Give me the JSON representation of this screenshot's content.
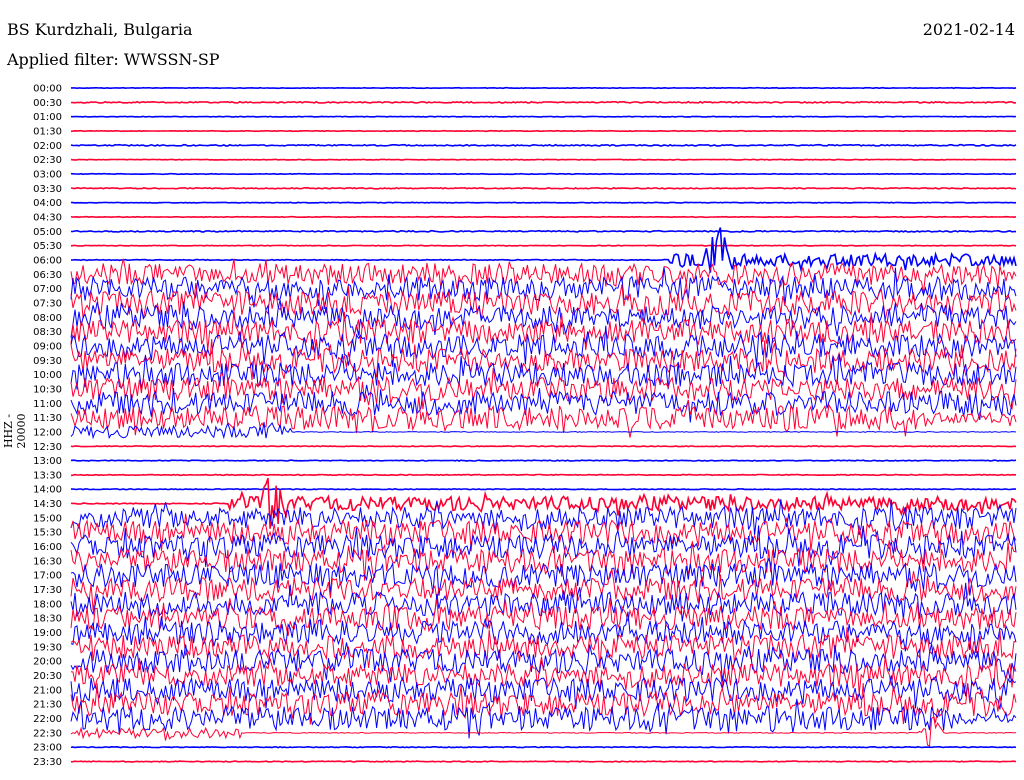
{
  "header": {
    "station": "BS Kurdzhali, Bulgaria",
    "filter": "Applied filter: WWSSN-SP",
    "date": "2021-02-14"
  },
  "chart_data": {
    "type": "line",
    "title": "BS Kurdzhali, Bulgaria",
    "ylabel": "HHZ - 20000",
    "xlabel": "",
    "x_unit": "minutes within 30-minute row",
    "xlim": [
      0,
      30
    ],
    "colors": {
      "even": "#0000ff",
      "odd": "#ff0033"
    },
    "rows": [
      {
        "time": "00:00",
        "amp": 0.3,
        "from": 0,
        "to": 30
      },
      {
        "time": "00:30",
        "amp": 0.6,
        "from": 0,
        "to": 30
      },
      {
        "time": "01:00",
        "amp": 0.3,
        "from": 0,
        "to": 30
      },
      {
        "time": "01:30",
        "amp": 0.3,
        "from": 0,
        "to": 30
      },
      {
        "time": "02:00",
        "amp": 0.6,
        "from": 0,
        "to": 30
      },
      {
        "time": "02:30",
        "amp": 0.3,
        "from": 0,
        "to": 30
      },
      {
        "time": "03:00",
        "amp": 0.3,
        "from": 0,
        "to": 30
      },
      {
        "time": "03:30",
        "amp": 0.5,
        "from": 0,
        "to": 30
      },
      {
        "time": "04:00",
        "amp": 0.3,
        "from": 0,
        "to": 30
      },
      {
        "time": "04:30",
        "amp": 0.3,
        "from": 0,
        "to": 30
      },
      {
        "time": "05:00",
        "amp": 0.6,
        "from": 0,
        "to": 30
      },
      {
        "time": "05:30",
        "amp": 0.3,
        "from": 0,
        "to": 30
      },
      {
        "time": "06:00",
        "amp": 0.4,
        "from": 0,
        "to": 30,
        "noisy_from": 19,
        "noisy_amp": 6,
        "spike_at": 20.5,
        "spike_amp": 40
      },
      {
        "time": "06:30",
        "amp": 11,
        "from": 0,
        "to": 30
      },
      {
        "time": "07:00",
        "amp": 12,
        "from": 0,
        "to": 30
      },
      {
        "time": "07:30",
        "amp": 12,
        "from": 0,
        "to": 30
      },
      {
        "time": "08:00",
        "amp": 12,
        "from": 0,
        "to": 30
      },
      {
        "time": "08:30",
        "amp": 12,
        "from": 0,
        "to": 30
      },
      {
        "time": "09:00",
        "amp": 12,
        "from": 0,
        "to": 30
      },
      {
        "time": "09:30",
        "amp": 12,
        "from": 0,
        "to": 30
      },
      {
        "time": "10:00",
        "amp": 12,
        "from": 0,
        "to": 30
      },
      {
        "time": "10:30",
        "amp": 12,
        "from": 0,
        "to": 30
      },
      {
        "time": "11:00",
        "amp": 12,
        "from": 0,
        "to": 30
      },
      {
        "time": "11:30",
        "amp": 12,
        "from": 0,
        "to": 30,
        "drop_at": 27.2,
        "drop_amp": 5
      },
      {
        "time": "12:00",
        "amp": 6,
        "from": 0,
        "to": 30,
        "quiet_after": 7,
        "spike_at": 6.4,
        "spike_amp": 14
      },
      {
        "time": "12:30",
        "amp": 0.4,
        "from": 0,
        "to": 30
      },
      {
        "time": "13:00",
        "amp": 0.4,
        "from": 0,
        "to": 30
      },
      {
        "time": "13:30",
        "amp": 0.4,
        "from": 0,
        "to": 30
      },
      {
        "time": "14:00",
        "amp": 0.4,
        "from": 0,
        "to": 30
      },
      {
        "time": "14:30",
        "amp": 0.5,
        "from": 0,
        "to": 30,
        "noisy_from": 5,
        "noisy_amp": 7,
        "spike_at": 6.4,
        "spike_amp": 30
      },
      {
        "time": "15:00",
        "amp": 11,
        "from": 0,
        "to": 30
      },
      {
        "time": "15:30",
        "amp": 12,
        "from": 0,
        "to": 30
      },
      {
        "time": "16:00",
        "amp": 12,
        "from": 0,
        "to": 30
      },
      {
        "time": "16:30",
        "amp": 12,
        "from": 0,
        "to": 30
      },
      {
        "time": "17:00",
        "amp": 12,
        "from": 0,
        "to": 30
      },
      {
        "time": "17:30",
        "amp": 12,
        "from": 0,
        "to": 30
      },
      {
        "time": "18:00",
        "amp": 12,
        "from": 0,
        "to": 30
      },
      {
        "time": "18:30",
        "amp": 12,
        "from": 0,
        "to": 30
      },
      {
        "time": "19:00",
        "amp": 12,
        "from": 0,
        "to": 30
      },
      {
        "time": "19:30",
        "amp": 12,
        "from": 0,
        "to": 30
      },
      {
        "time": "20:00",
        "amp": 12,
        "from": 0,
        "to": 30
      },
      {
        "time": "20:30",
        "amp": 12,
        "from": 0,
        "to": 30
      },
      {
        "time": "21:00",
        "amp": 12,
        "from": 0,
        "to": 30
      },
      {
        "time": "21:30",
        "amp": 12,
        "from": 0,
        "to": 30
      },
      {
        "time": "22:00",
        "amp": 12,
        "from": 0,
        "to": 30,
        "drop_at": 28,
        "drop_amp": 6
      },
      {
        "time": "22:30",
        "amp": 5,
        "from": 0,
        "to": 30,
        "quiet_after": 5.4,
        "spike_at": 27.3,
        "spike_amp": 22
      },
      {
        "time": "23:00",
        "amp": 0.4,
        "from": 0,
        "to": 30
      },
      {
        "time": "23:30",
        "amp": 0.4,
        "from": 0,
        "to": 30
      }
    ]
  }
}
